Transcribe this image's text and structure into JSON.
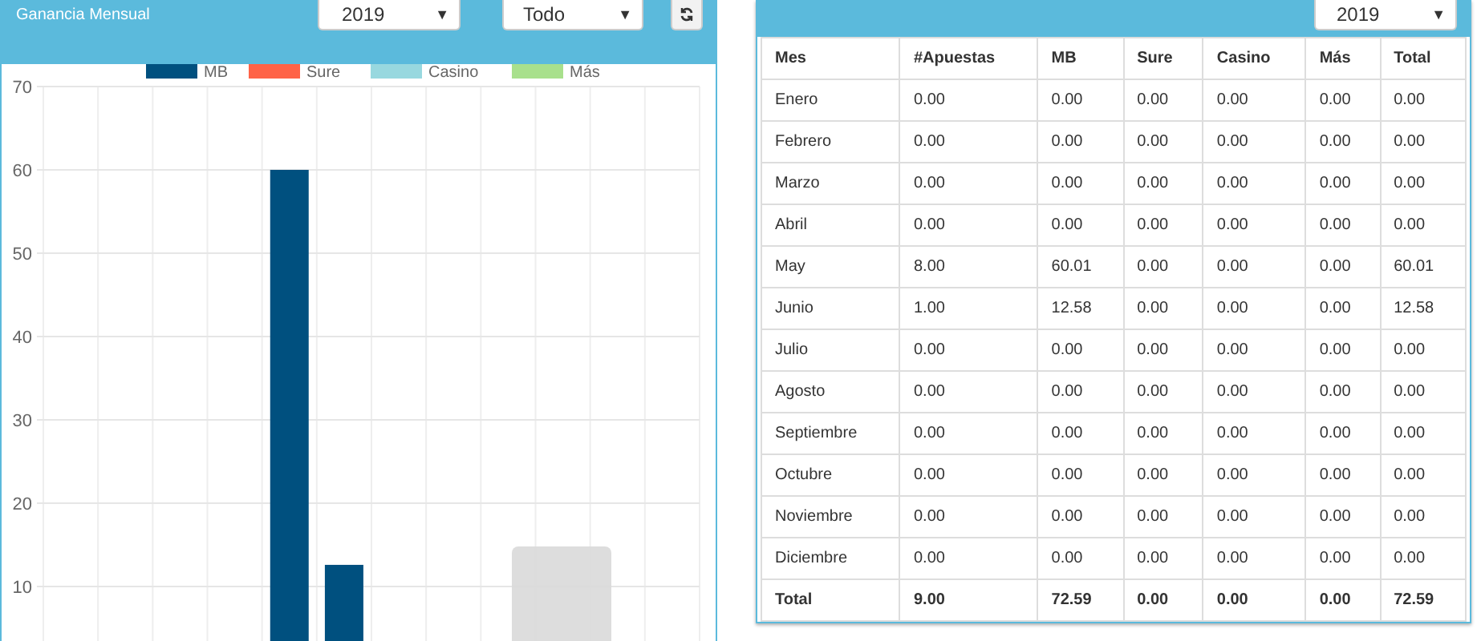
{
  "left_panel": {
    "title": "Ganancia Mensual",
    "year_select": {
      "value": "2019",
      "caret": "▼"
    },
    "filter_select": {
      "value": "Todo",
      "caret": "▼"
    },
    "chart_data": {
      "type": "bar",
      "grid": true,
      "ylim": [
        0,
        70
      ],
      "yticks": [
        10,
        20,
        30,
        40,
        50,
        60,
        70
      ],
      "series": [
        {
          "name": "MB",
          "color": "#00507f",
          "values": [
            0,
            0,
            0,
            0,
            60,
            12.6,
            0,
            0,
            0,
            0,
            0,
            0
          ]
        },
        {
          "name": "Sure",
          "color": "#ff6347",
          "values": [
            0,
            0,
            0,
            0,
            0,
            0,
            0,
            0,
            0,
            0,
            0,
            0
          ]
        },
        {
          "name": "Casino",
          "color": "#98d8df",
          "values": [
            0,
            0,
            0,
            0,
            0,
            0,
            0,
            0,
            0,
            0,
            0,
            0
          ]
        },
        {
          "name": "Más",
          "color": "#a8e08c",
          "values": [
            0,
            0,
            0,
            0,
            0,
            0,
            0,
            0,
            0,
            0,
            0,
            0
          ]
        }
      ]
    }
  },
  "right_panel": {
    "year_select": {
      "value": "2019",
      "caret": "▼"
    },
    "table": {
      "columns": [
        "Mes",
        "#Apuestas",
        "MB",
        "Sure",
        "Casino",
        "Más",
        "Total"
      ],
      "rows": [
        [
          "Enero",
          "0.00",
          "0.00",
          "0.00",
          "0.00",
          "0.00",
          "0.00"
        ],
        [
          "Febrero",
          "0.00",
          "0.00",
          "0.00",
          "0.00",
          "0.00",
          "0.00"
        ],
        [
          "Marzo",
          "0.00",
          "0.00",
          "0.00",
          "0.00",
          "0.00",
          "0.00"
        ],
        [
          "Abril",
          "0.00",
          "0.00",
          "0.00",
          "0.00",
          "0.00",
          "0.00"
        ],
        [
          "May",
          "8.00",
          "60.01",
          "0.00",
          "0.00",
          "0.00",
          "60.01"
        ],
        [
          "Junio",
          "1.00",
          "12.58",
          "0.00",
          "0.00",
          "0.00",
          "12.58"
        ],
        [
          "Julio",
          "0.00",
          "0.00",
          "0.00",
          "0.00",
          "0.00",
          "0.00"
        ],
        [
          "Agosto",
          "0.00",
          "0.00",
          "0.00",
          "0.00",
          "0.00",
          "0.00"
        ],
        [
          "Septiembre",
          "0.00",
          "0.00",
          "0.00",
          "0.00",
          "0.00",
          "0.00"
        ],
        [
          "Octubre",
          "0.00",
          "0.00",
          "0.00",
          "0.00",
          "0.00",
          "0.00"
        ],
        [
          "Noviembre",
          "0.00",
          "0.00",
          "0.00",
          "0.00",
          "0.00",
          "0.00"
        ],
        [
          "Diciembre",
          "0.00",
          "0.00",
          "0.00",
          "0.00",
          "0.00",
          "0.00"
        ]
      ],
      "total_row": [
        "Total",
        "9.00",
        "72.59",
        "0.00",
        "0.00",
        "0.00",
        "72.59"
      ]
    }
  }
}
